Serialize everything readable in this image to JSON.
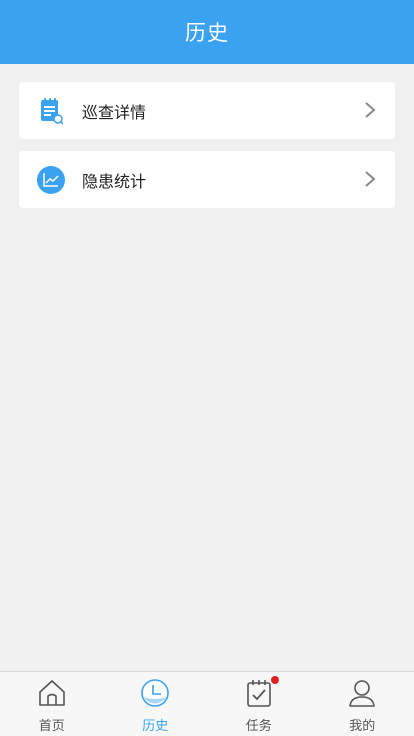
{
  "header": {
    "title": "历史"
  },
  "menu": {
    "items": [
      {
        "label": "巡查详情",
        "icon": "clipboard-search-icon"
      },
      {
        "label": "隐患统计",
        "icon": "line-chart-icon"
      }
    ]
  },
  "tabbar": {
    "tabs": [
      {
        "label": "首页",
        "icon": "home-icon",
        "active": false
      },
      {
        "label": "历史",
        "icon": "clock-icon",
        "active": true
      },
      {
        "label": "任务",
        "icon": "task-calendar-icon",
        "active": false,
        "badge": true
      },
      {
        "label": "我的",
        "icon": "user-icon",
        "active": false
      }
    ]
  },
  "colors": {
    "primary": "#3aa2f0",
    "badge": "#e02020",
    "background": "#f0f0f0"
  }
}
